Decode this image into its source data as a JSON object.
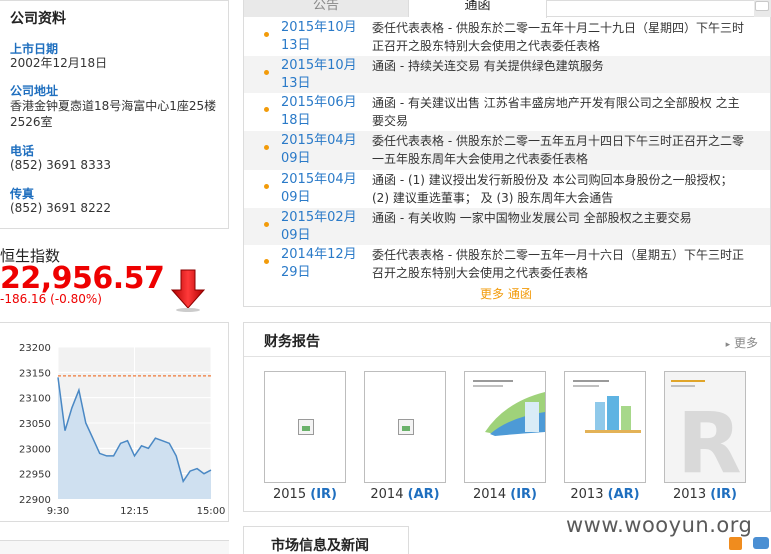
{
  "company": {
    "heading": "公司资料",
    "listing_date_label": "上市日期",
    "listing_date": "2002年12月18日",
    "address_label": "公司地址",
    "address": "香港金钟夏悫道18号海富中心1座25楼2526室",
    "phone_label": "电话",
    "phone": "(852) 3691 8333",
    "fax_label": "传真",
    "fax": "(852) 3691 8222"
  },
  "hsi": {
    "title": "恒生指数",
    "value": "22,956.57",
    "change": "-186.16 (-0.80%)",
    "trend_icon": "down-arrow-icon",
    "colors": {
      "down": "#e00000"
    }
  },
  "chart_data": {
    "type": "area",
    "title": "",
    "xlabel": "",
    "ylabel": "",
    "x_ticks": [
      "9:30",
      "12:15",
      "15:00"
    ],
    "y_ticks": [
      23200,
      23150,
      23100,
      23050,
      23000,
      22950,
      22900
    ],
    "ylim": [
      22900,
      23200
    ],
    "grid": true,
    "reference_line": {
      "value": 23143,
      "color": "#f07a3a",
      "style": "dashed",
      "meaning": "previous close"
    },
    "series": [
      {
        "values": [
          23140,
          23035,
          23080,
          23115,
          23050,
          23020,
          22990,
          22985,
          22985,
          23010,
          23015,
          22985,
          23005,
          23000,
          23020,
          23015,
          23010,
          22985,
          22935,
          22955,
          22960,
          22950,
          22957
        ],
        "color": "#4a88c4",
        "fill": "#cfe0f0"
      }
    ]
  },
  "tabs": {
    "announcements": "公告",
    "circulars": "通函"
  },
  "circulars": [
    {
      "date": "2015年10月13日",
      "text": "委任代表表格 - 供股东於二零一五年十月二十九日（星期四）下午三时正召开之股东特别大会使用之代表委任表格"
    },
    {
      "date": "2015年10月13日",
      "text": "通函 - 持续关连交易 有关提供绿色建筑服务"
    },
    {
      "date": "2015年06月18日",
      "text": "通函 - 有关建议出售 江苏省丰盛房地产开发有限公司之全部股权 之主要交易"
    },
    {
      "date": "2015年04月09日",
      "text": "委任代表表格 - 供股东於二零一五年五月十四日下午三时正召开之二零一五年股东周年大会使用之代表委任表格"
    },
    {
      "date": "2015年04月09日",
      "text": "通函 - (1) 建议授出发行新股份及 本公司购回本身股份之一般授权；(2) 建议重选董事； 及 (3) 股东周年大会通告"
    },
    {
      "date": "2015年02月09日",
      "text": "通函 - 有关收购 一家中国物业发展公司 全部股权之主要交易"
    },
    {
      "date": "2014年12月29日",
      "text": "委任代表表格 - 供股东於二零一五年一月十六日（星期五）下午三时正召开之股东特别大会使用之代表委任表格"
    }
  ],
  "more_circulars": "更多 通函",
  "financial": {
    "title": "财务报告",
    "more": "更多",
    "reports": [
      {
        "year": "2015",
        "type": "(IR)"
      },
      {
        "year": "2014",
        "type": "(AR)"
      },
      {
        "year": "2014",
        "type": "(IR)"
      },
      {
        "year": "2013",
        "type": "(AR)"
      },
      {
        "year": "2013",
        "type": "(IR)"
      }
    ]
  },
  "news": {
    "title": "市场信息及新闻"
  },
  "watermark": "www.wooyun.org"
}
